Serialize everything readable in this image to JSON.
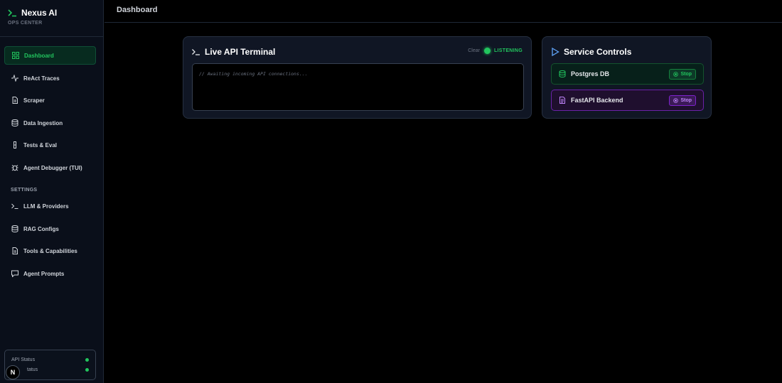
{
  "brand": {
    "title": "Nexus AI",
    "subtitle": "OPS CENTER",
    "icon": "terminal-icon",
    "accent": "#22c55e"
  },
  "sidebar": {
    "items": [
      {
        "label": "Dashboard",
        "icon": "grid-icon",
        "active": true
      },
      {
        "label": "ReAct Traces",
        "icon": "activity-icon"
      },
      {
        "label": "Scraper",
        "icon": "file-icon"
      },
      {
        "label": "Data Ingestion",
        "icon": "database-icon"
      },
      {
        "label": "Tests & Eval",
        "icon": "flask-icon"
      },
      {
        "label": "Agent Debugger (TUI)",
        "icon": "bug-icon"
      }
    ],
    "settings_label": "SETTINGS",
    "settings_items": [
      {
        "label": "LLM & Providers",
        "icon": "terminal-icon"
      },
      {
        "label": "RAG Configs",
        "icon": "database-icon"
      },
      {
        "label": "Tools & Capabilities",
        "icon": "file-icon"
      },
      {
        "label": "Agent Prompts",
        "icon": "message-icon"
      }
    ],
    "status": [
      {
        "label": "API Status",
        "color": "#22c55e"
      },
      {
        "label": "tatus",
        "color": "#22c55e"
      }
    ],
    "badge": "N"
  },
  "header": {
    "title": "Dashboard"
  },
  "terminal": {
    "title": "Live API Terminal",
    "clear_label": "Clear",
    "state_label": "LISTENING",
    "placeholder_line": "// Awaiting incoming API connections..."
  },
  "services": {
    "title": "Service Controls",
    "items": [
      {
        "name": "Postgres DB",
        "action": "Stop",
        "icon": "database-icon",
        "color": "#22c55e"
      },
      {
        "name": "FastAPI Backend",
        "action": "Stop",
        "icon": "server-icon",
        "color": "#c084fc"
      }
    ]
  }
}
